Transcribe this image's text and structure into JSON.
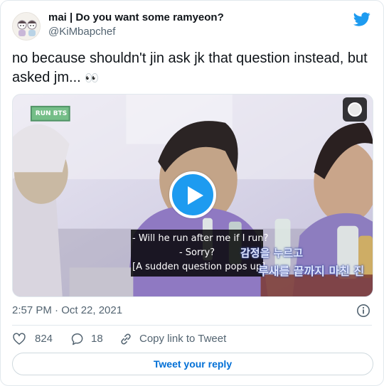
{
  "tweet": {
    "display_name": "mai | Do you want some ramyeon?",
    "handle": "@KiMbapchef",
    "text": "no because shouldn't jin ask jk that question instead, but asked jm...",
    "text_emoji": "👀",
    "timestamp": "2:57 PM · Oct 22, 2021"
  },
  "media": {
    "subtitles": [
      "- Will he run after me if I run?",
      "- Sorry?",
      "[A sudden question pops up]"
    ],
    "korean_caption_1": "감정을 누르고",
    "korean_caption_2": "루새를 끝까지 마친 진",
    "show_logo_text": "RUN BTS"
  },
  "actions": {
    "likes": "824",
    "replies": "18",
    "copy_link_label": "Copy link to Tweet"
  },
  "reply_button_label": "Tweet your reply",
  "colors": {
    "brand_blue": "#1d9bf0",
    "link_blue": "#006fd6",
    "muted_text": "#536471",
    "border": "#e1e8ed"
  },
  "icons": {
    "brand": "twitter-bird-icon",
    "info": "info-icon",
    "like": "heart-icon",
    "reply": "speech-bubble-icon",
    "copy": "link-icon",
    "play": "play-icon"
  }
}
